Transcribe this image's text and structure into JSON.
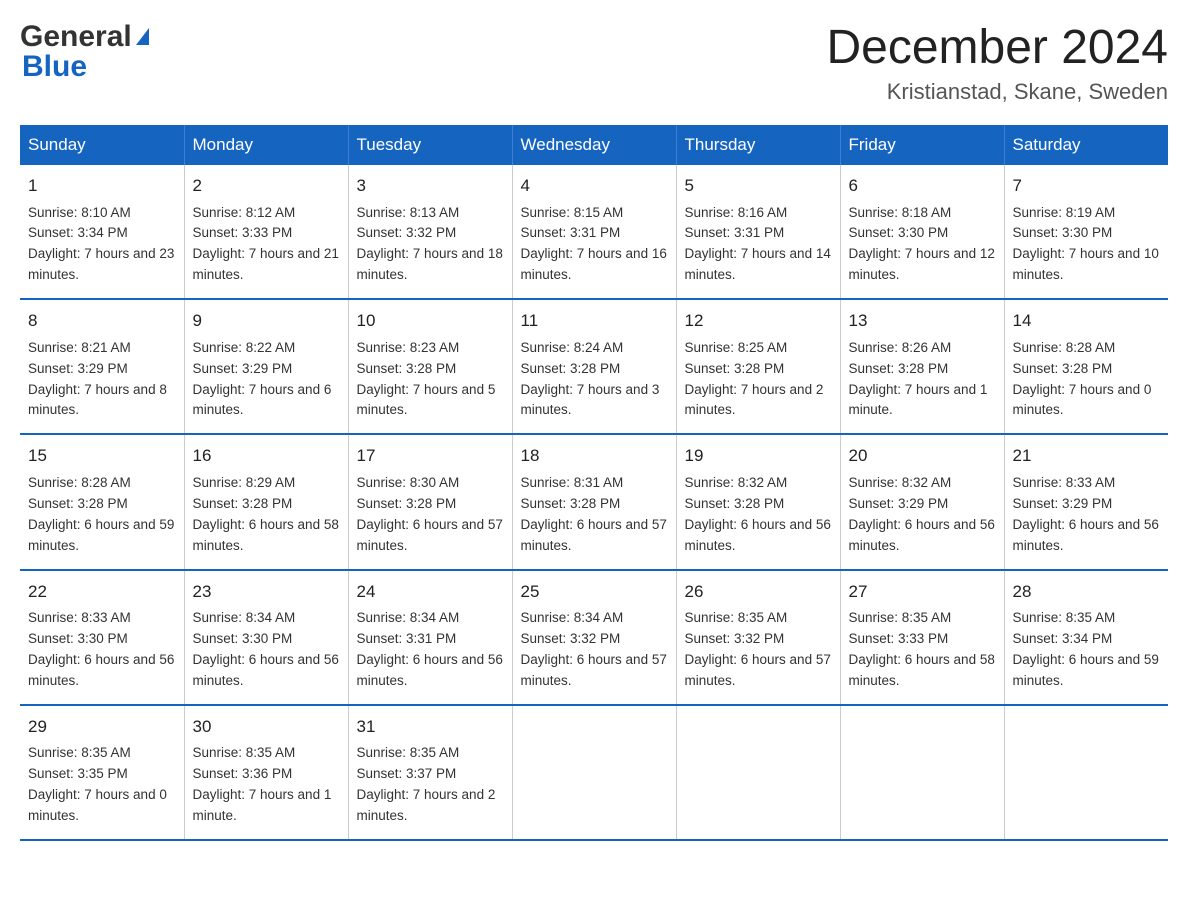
{
  "header": {
    "logo_general": "General",
    "logo_blue": "Blue",
    "month_title": "December 2024",
    "location": "Kristianstad, Skane, Sweden"
  },
  "days_of_week": [
    "Sunday",
    "Monday",
    "Tuesday",
    "Wednesday",
    "Thursday",
    "Friday",
    "Saturday"
  ],
  "weeks": [
    [
      {
        "day": "1",
        "sunrise": "8:10 AM",
        "sunset": "3:34 PM",
        "daylight": "7 hours and 23 minutes."
      },
      {
        "day": "2",
        "sunrise": "8:12 AM",
        "sunset": "3:33 PM",
        "daylight": "7 hours and 21 minutes."
      },
      {
        "day": "3",
        "sunrise": "8:13 AM",
        "sunset": "3:32 PM",
        "daylight": "7 hours and 18 minutes."
      },
      {
        "day": "4",
        "sunrise": "8:15 AM",
        "sunset": "3:31 PM",
        "daylight": "7 hours and 16 minutes."
      },
      {
        "day": "5",
        "sunrise": "8:16 AM",
        "sunset": "3:31 PM",
        "daylight": "7 hours and 14 minutes."
      },
      {
        "day": "6",
        "sunrise": "8:18 AM",
        "sunset": "3:30 PM",
        "daylight": "7 hours and 12 minutes."
      },
      {
        "day": "7",
        "sunrise": "8:19 AM",
        "sunset": "3:30 PM",
        "daylight": "7 hours and 10 minutes."
      }
    ],
    [
      {
        "day": "8",
        "sunrise": "8:21 AM",
        "sunset": "3:29 PM",
        "daylight": "7 hours and 8 minutes."
      },
      {
        "day": "9",
        "sunrise": "8:22 AM",
        "sunset": "3:29 PM",
        "daylight": "7 hours and 6 minutes."
      },
      {
        "day": "10",
        "sunrise": "8:23 AM",
        "sunset": "3:28 PM",
        "daylight": "7 hours and 5 minutes."
      },
      {
        "day": "11",
        "sunrise": "8:24 AM",
        "sunset": "3:28 PM",
        "daylight": "7 hours and 3 minutes."
      },
      {
        "day": "12",
        "sunrise": "8:25 AM",
        "sunset": "3:28 PM",
        "daylight": "7 hours and 2 minutes."
      },
      {
        "day": "13",
        "sunrise": "8:26 AM",
        "sunset": "3:28 PM",
        "daylight": "7 hours and 1 minute."
      },
      {
        "day": "14",
        "sunrise": "8:28 AM",
        "sunset": "3:28 PM",
        "daylight": "7 hours and 0 minutes."
      }
    ],
    [
      {
        "day": "15",
        "sunrise": "8:28 AM",
        "sunset": "3:28 PM",
        "daylight": "6 hours and 59 minutes."
      },
      {
        "day": "16",
        "sunrise": "8:29 AM",
        "sunset": "3:28 PM",
        "daylight": "6 hours and 58 minutes."
      },
      {
        "day": "17",
        "sunrise": "8:30 AM",
        "sunset": "3:28 PM",
        "daylight": "6 hours and 57 minutes."
      },
      {
        "day": "18",
        "sunrise": "8:31 AM",
        "sunset": "3:28 PM",
        "daylight": "6 hours and 57 minutes."
      },
      {
        "day": "19",
        "sunrise": "8:32 AM",
        "sunset": "3:28 PM",
        "daylight": "6 hours and 56 minutes."
      },
      {
        "day": "20",
        "sunrise": "8:32 AM",
        "sunset": "3:29 PM",
        "daylight": "6 hours and 56 minutes."
      },
      {
        "day": "21",
        "sunrise": "8:33 AM",
        "sunset": "3:29 PM",
        "daylight": "6 hours and 56 minutes."
      }
    ],
    [
      {
        "day": "22",
        "sunrise": "8:33 AM",
        "sunset": "3:30 PM",
        "daylight": "6 hours and 56 minutes."
      },
      {
        "day": "23",
        "sunrise": "8:34 AM",
        "sunset": "3:30 PM",
        "daylight": "6 hours and 56 minutes."
      },
      {
        "day": "24",
        "sunrise": "8:34 AM",
        "sunset": "3:31 PM",
        "daylight": "6 hours and 56 minutes."
      },
      {
        "day": "25",
        "sunrise": "8:34 AM",
        "sunset": "3:32 PM",
        "daylight": "6 hours and 57 minutes."
      },
      {
        "day": "26",
        "sunrise": "8:35 AM",
        "sunset": "3:32 PM",
        "daylight": "6 hours and 57 minutes."
      },
      {
        "day": "27",
        "sunrise": "8:35 AM",
        "sunset": "3:33 PM",
        "daylight": "6 hours and 58 minutes."
      },
      {
        "day": "28",
        "sunrise": "8:35 AM",
        "sunset": "3:34 PM",
        "daylight": "6 hours and 59 minutes."
      }
    ],
    [
      {
        "day": "29",
        "sunrise": "8:35 AM",
        "sunset": "3:35 PM",
        "daylight": "7 hours and 0 minutes."
      },
      {
        "day": "30",
        "sunrise": "8:35 AM",
        "sunset": "3:36 PM",
        "daylight": "7 hours and 1 minute."
      },
      {
        "day": "31",
        "sunrise": "8:35 AM",
        "sunset": "3:37 PM",
        "daylight": "7 hours and 2 minutes."
      },
      null,
      null,
      null,
      null
    ]
  ]
}
